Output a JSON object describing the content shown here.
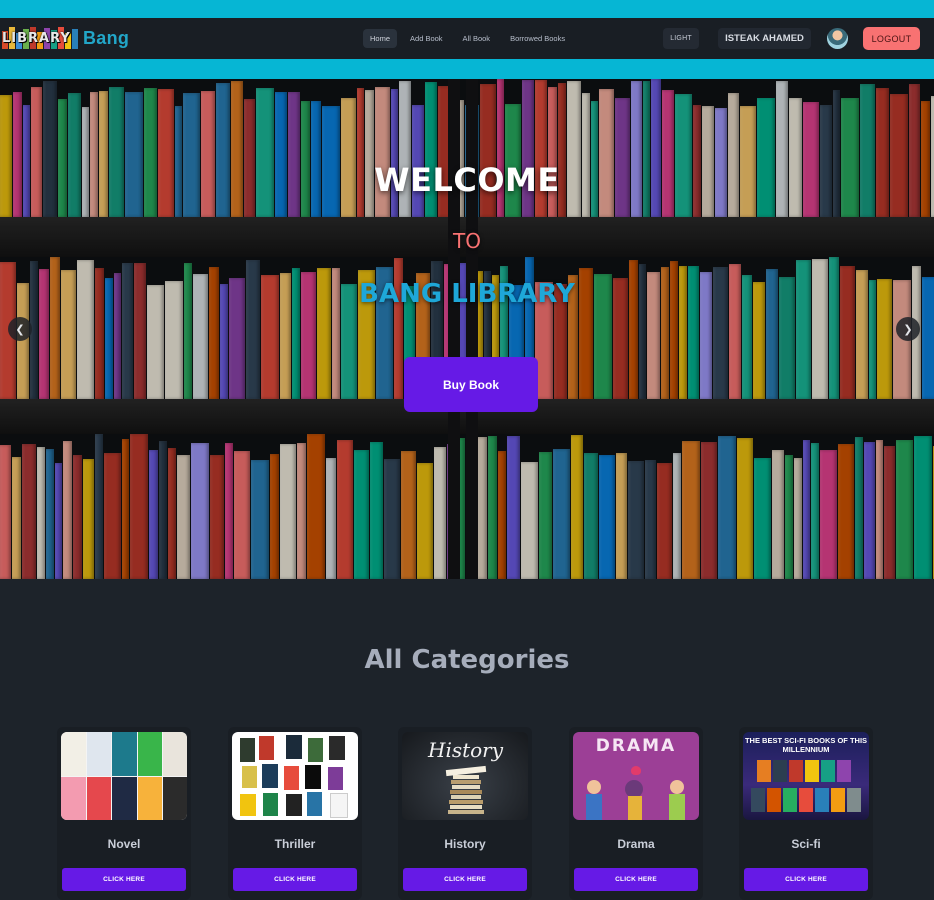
{
  "navbar": {
    "logo_text": "LIBRARY",
    "brand": "Bang",
    "links": [
      "Home",
      "Add Book",
      "All Book",
      "Borrowed Books"
    ],
    "active_link": "Home",
    "theme_toggle": "LIGHT",
    "user_name": "ISTEAK AHAMED",
    "logout": "LOGOUT"
  },
  "hero": {
    "line1": "WELCOME",
    "line2": "TO",
    "line3": "BANG LIBRARY",
    "cta": "Buy Book",
    "prev_arrow": "❮",
    "next_arrow": "❯"
  },
  "categories": {
    "title": "All Categories",
    "items": [
      {
        "name": "Novel",
        "button": "CLICK HERE"
      },
      {
        "name": "Thriller",
        "button": "CLICK HERE"
      },
      {
        "name": "History",
        "button": "CLICK HERE",
        "image_text": "History"
      },
      {
        "name": "Drama",
        "button": "CLICK HERE",
        "image_text": "DRAMA"
      },
      {
        "name": "Sci-fi",
        "button": "CLICK HERE",
        "image_text": "THE BEST SCI-FI BOOKS OF THIS MILLENNIUM"
      }
    ]
  },
  "colors": {
    "accent_cyan": "#06b6d4",
    "primary_purple": "#661ae6",
    "logout_red": "#f87272",
    "background": "#1d232a"
  }
}
